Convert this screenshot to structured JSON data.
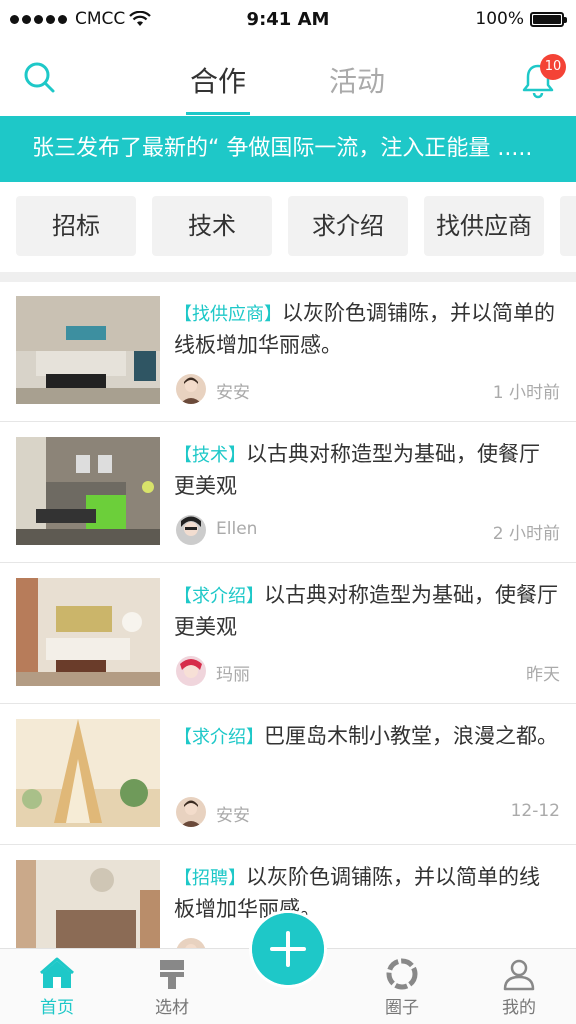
{
  "status_bar": {
    "carrier": "CMCC",
    "time": "9:41 AM",
    "battery": "100%"
  },
  "nav": {
    "tab_active": "合作",
    "tab_inactive": "活动",
    "notification_count": "10"
  },
  "banner": {
    "text": "张三发布了最新的“ 争做国际一流，注入正能量 ....."
  },
  "categories": [
    "招标",
    "技术",
    "求介绍",
    "找供应商"
  ],
  "feed": [
    {
      "tag": "【找供应商】",
      "title": "以灰阶色调铺陈，并以简单的线板增加华丽感。",
      "author": "安安",
      "time": "1 小时前"
    },
    {
      "tag": "【技术】",
      "title": "以古典对称造型为基础，使餐厅更美观",
      "author": "Ellen",
      "time": "2 小时前"
    },
    {
      "tag": "【求介绍】",
      "title": "以古典对称造型为基础，使餐厅更美观",
      "author": "玛丽",
      "time": "昨天"
    },
    {
      "tag": "【求介绍】",
      "title": "巴厘岛木制小教堂，浪漫之都。",
      "author": "安安",
      "time": "12-12"
    },
    {
      "tag": "【招聘】",
      "title": "以灰阶色调铺陈，并以简单的线板增加华丽感。",
      "author": "",
      "time": ""
    }
  ],
  "tabbar": {
    "home": "首页",
    "materials": "选材",
    "circle": "圈子",
    "mine": "我的"
  },
  "colors": {
    "accent": "#1ec8c8",
    "badge": "#f44336"
  }
}
